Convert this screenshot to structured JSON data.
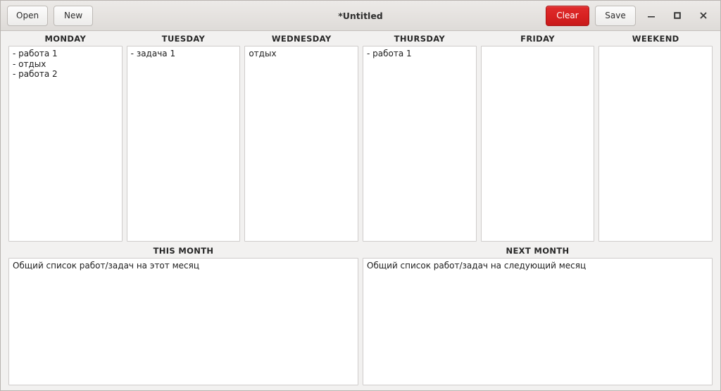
{
  "window": {
    "title": "*Untitled",
    "accent_clear": "#d72121",
    "background": "#f2f1f0"
  },
  "toolbar": {
    "open_label": "Open",
    "new_label": "New",
    "clear_label": "Clear",
    "save_label": "Save"
  },
  "window_controls": {
    "minimize": "–",
    "maximize": "□",
    "close": "✕"
  },
  "days": [
    {
      "header": "MONDAY",
      "value": "- работа 1\n- отдых\n- работа 2"
    },
    {
      "header": "TUESDAY",
      "value": "- задача 1"
    },
    {
      "header": "WEDNESDAY",
      "value": "отдых"
    },
    {
      "header": "THURSDAY",
      "value": "- работа 1"
    },
    {
      "header": "FRIDAY",
      "value": ""
    },
    {
      "header": "WEEKEND",
      "value": ""
    }
  ],
  "months": [
    {
      "header": "THIS MONTH",
      "value": "Общий список работ/задач на этот месяц"
    },
    {
      "header": "NEXT MONTH",
      "value": "Общий список работ/задач на следующий месяц"
    }
  ]
}
